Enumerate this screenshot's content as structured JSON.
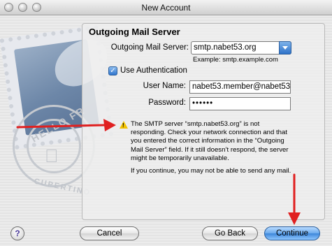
{
  "window": {
    "title": "New Account"
  },
  "panel": {
    "section_title": "Outgoing Mail Server",
    "server_label": "Outgoing Mail Server:",
    "server_value": "smtp.nabet53.org",
    "server_example": "Example: smtp.example.com",
    "use_auth_label": "Use Authentication",
    "use_auth_checked": true,
    "username_label": "User Name:",
    "username_value": "nabet53.member@nabet53",
    "password_label": "Password:",
    "password_value": "••••••",
    "warning_message": "The SMTP server “smtp.nabet53.org” is not responding. Check your network connection and that you entered the correct information in the “Outgoing Mail Server” field. If it still doesn’t respond, the server might be temporarily unavailable.",
    "continue_note": "If you continue, you may not be able to send any mail."
  },
  "buttons": {
    "help_label": "?",
    "cancel_label": "Cancel",
    "goback_label": "Go Back",
    "continue_label": "Continue"
  },
  "stamp": {
    "postmark_text_top": "HELLO FR",
    "postmark_text_bottom": "CUPERTINO"
  },
  "colors": {
    "annotation_arrow": "#e02020",
    "warning": "#f2c200",
    "default_button": "#3d86d9"
  },
  "icons": {
    "warning": "warning-triangle-icon",
    "help": "help-icon",
    "dropdown": "chevron-down-icon",
    "apple": "apple-logo-icon"
  }
}
